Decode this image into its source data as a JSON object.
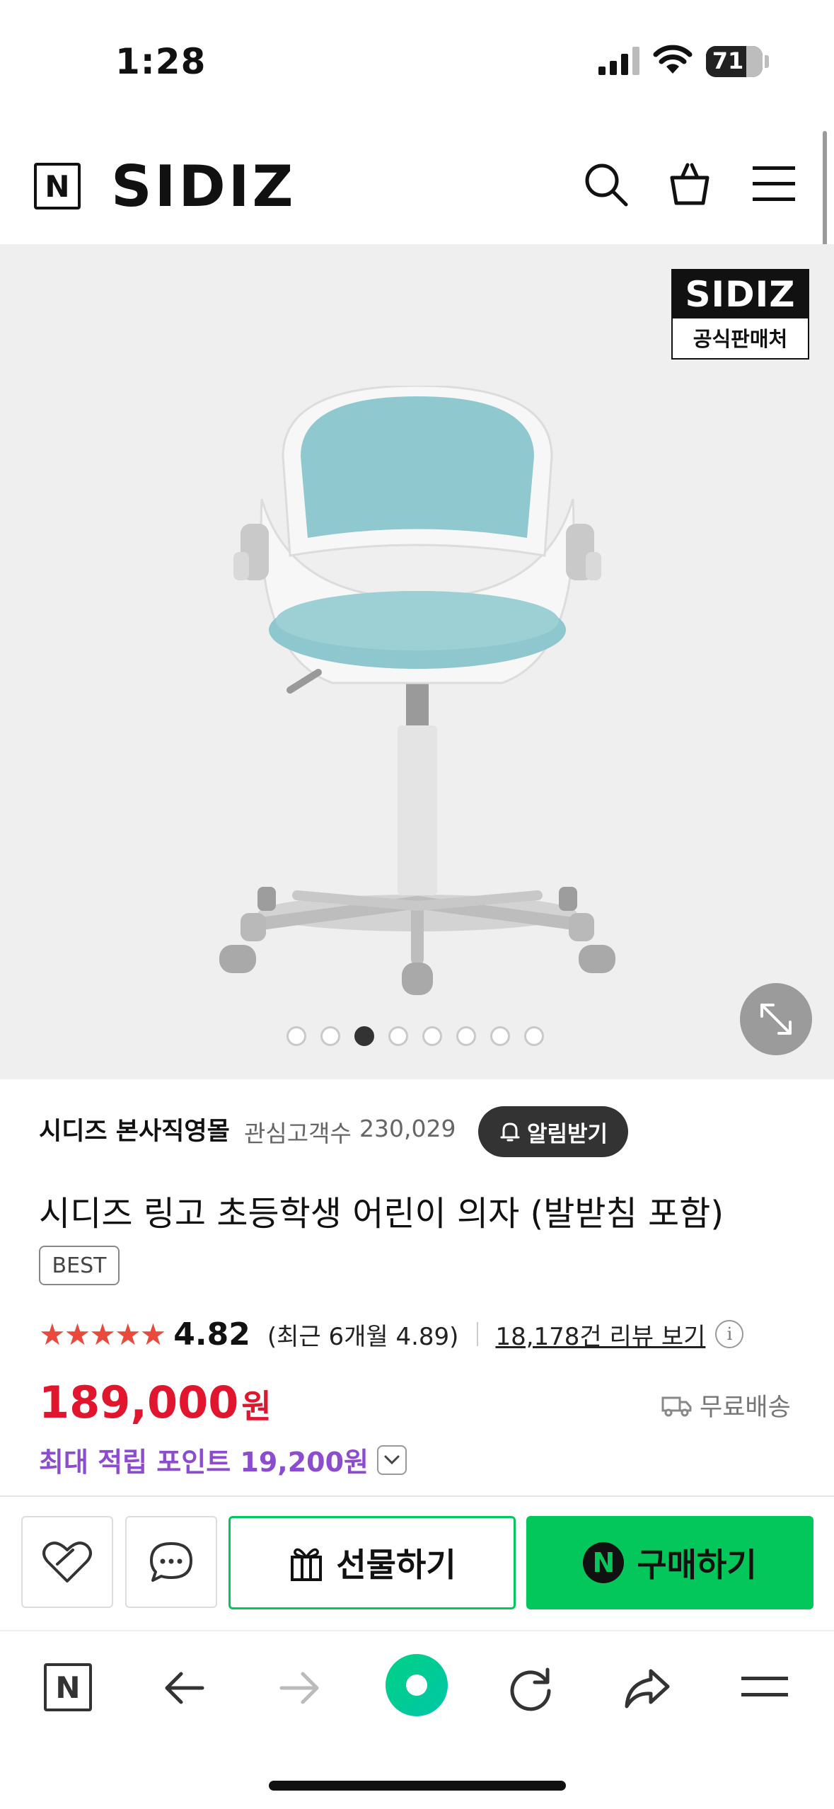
{
  "status_bar": {
    "time": "1:28",
    "battery": "71"
  },
  "header": {
    "logo": "N",
    "brand": "SIDIZ"
  },
  "hero": {
    "badge_brand": "SIDIZ",
    "badge_label": "공식판매처",
    "image_count": 8,
    "active_index": 2
  },
  "seller": {
    "name": "시디즈 본사직영몰",
    "followers_label": "관심고객수",
    "followers_count": "230,029",
    "alert_button": "알림받기"
  },
  "product": {
    "title": "시디즈 링고 초등학생 어린이 의자 (발받침 포함)",
    "tag": "BEST",
    "rating": "4.82",
    "recent_rating": "(최근 6개월 4.89)",
    "reviews_link": "18,178건 리뷰 보기",
    "price": "189,000",
    "price_unit": "원",
    "shipping": "무료배송",
    "points": "최대 적립 포인트 19,200원"
  },
  "actions": {
    "gift_label": "선물하기",
    "buy_label": "구매하기",
    "buy_badge": "N"
  },
  "colors": {
    "naver_green": "#03c75a",
    "price_red": "#e2152e",
    "points_purple": "#8b4ccf",
    "star_red": "#e94a3c"
  }
}
